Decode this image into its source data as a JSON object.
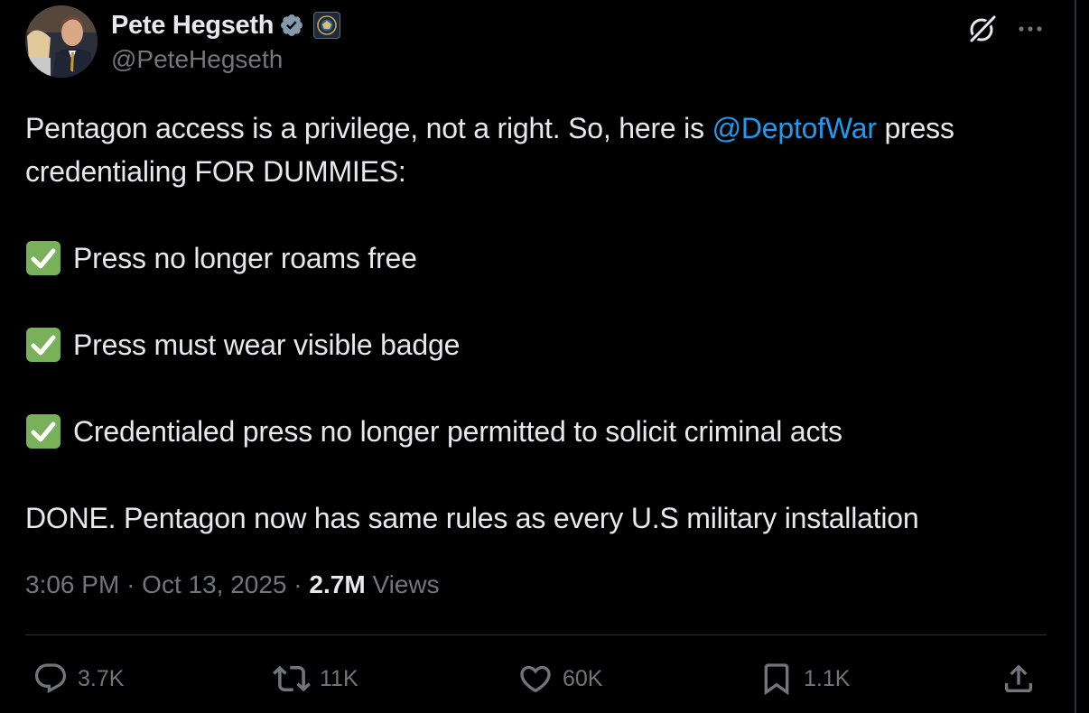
{
  "author": {
    "display_name": "Pete Hegseth",
    "handle": "@PeteHegseth",
    "verified_icon": "verified-badge-icon",
    "affiliation_icon": "department-seal-badge"
  },
  "header_actions": {
    "grok_icon": "grok-icon",
    "more_icon": "more-options-icon"
  },
  "tweet": {
    "line1_before": "Pentagon access is a privilege, not a right. So, here is ",
    "mention": "@DeptofWar",
    "line1_after": " press credentialing FOR DUMMIES:",
    "checklist": [
      "Press no longer roams free",
      "Press must wear visible badge",
      "Credentialed press no longer permitted to solicit criminal acts"
    ],
    "closing": "DONE. Pentagon now has same rules as every U.S military installation"
  },
  "meta": {
    "time": "3:06 PM",
    "separator": "·",
    "date": "Oct 13, 2025",
    "views_count": "2.7M",
    "views_label": "Views"
  },
  "actions": {
    "replies": "3.7K",
    "reposts": "11K",
    "likes": "60K",
    "bookmarks": "1.1K"
  },
  "colors": {
    "background": "#000000",
    "text": "#e7e9ea",
    "secondary": "#71767b",
    "link": "#1d9bf0",
    "verified": "#829aab",
    "check_emoji": "#78b159",
    "divider": "#2f3336"
  }
}
